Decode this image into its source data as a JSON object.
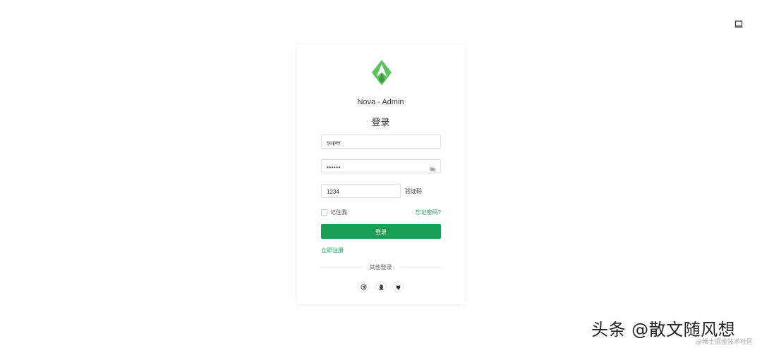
{
  "app": {
    "title": "Nova - Admin",
    "brand_color": "#1a9e55",
    "logo_color": "#5ec15e"
  },
  "login": {
    "heading": "登录",
    "username_value": "super",
    "password_value": "••••••",
    "captcha_value": "1234",
    "captcha_label": "验证码",
    "remember_label": "记住我",
    "forgot_label": "忘记密码?",
    "submit_label": "登录",
    "register_label": "立即注册",
    "other_login_label": "其他登录",
    "social_icons": [
      "dingtalk-icon",
      "qq-icon",
      "github-icon"
    ]
  },
  "watermark": {
    "main": "头条 @散文随风想",
    "sub": "@稀土掘金技术社区"
  }
}
